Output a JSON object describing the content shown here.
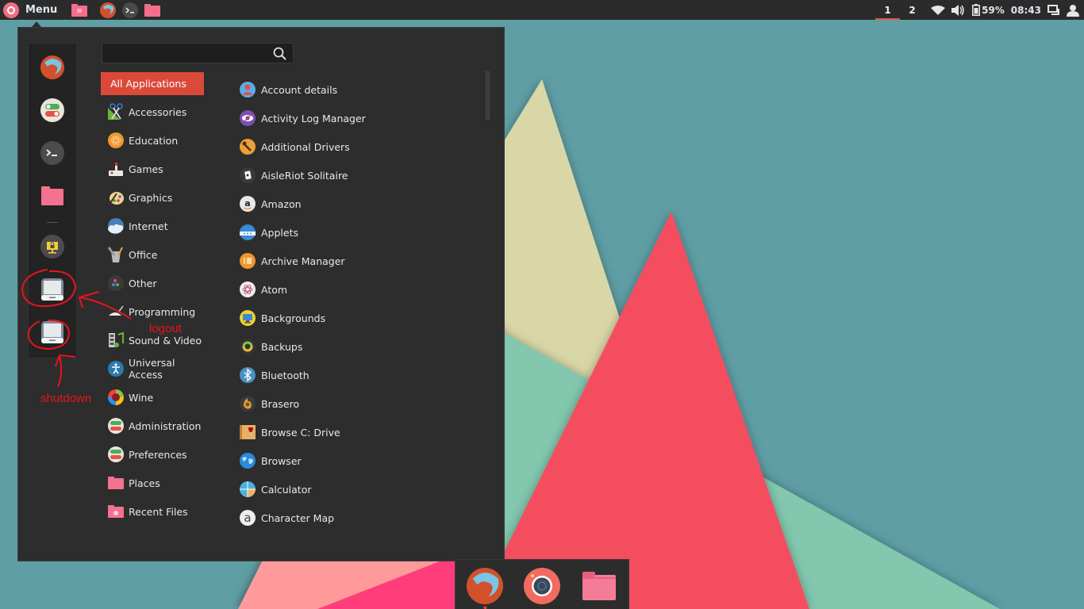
{
  "colors": {
    "panel_bg": "#2b2b2b",
    "menu_bg": "#2d2d2d",
    "accent": "#db4a39",
    "wallpaper_bg": "#5f9ea5",
    "annotation": "#e8141a"
  },
  "top_panel": {
    "menu_label": "Menu",
    "launchers": [
      {
        "name": "files-launcher",
        "icon": "folder-icon"
      },
      {
        "name": "firefox-launcher",
        "icon": "firefox-icon"
      },
      {
        "name": "terminal-launcher",
        "icon": "terminal-icon"
      },
      {
        "name": "folder-launcher",
        "icon": "folder-icon"
      }
    ],
    "workspaces": [
      "1",
      "2"
    ],
    "active_workspace": "1",
    "battery": "59%",
    "clock": "08:43"
  },
  "menu": {
    "search": {
      "value": "",
      "placeholder": ""
    },
    "favorites": [
      {
        "name": "firefox",
        "icon": "firefox-icon"
      },
      {
        "name": "system-settings",
        "icon": "settings-toggle-icon"
      },
      {
        "name": "terminal",
        "icon": "terminal-icon"
      },
      {
        "name": "files",
        "icon": "folder-icon"
      },
      {
        "name": "lock-screen",
        "icon": "lock-screen-icon"
      },
      {
        "name": "logout",
        "icon": "computer-icon"
      },
      {
        "name": "shutdown",
        "icon": "computer-icon"
      }
    ],
    "categories": [
      {
        "label": "All Applications",
        "selected": true
      },
      {
        "label": "Accessories"
      },
      {
        "label": "Education"
      },
      {
        "label": "Games"
      },
      {
        "label": "Graphics"
      },
      {
        "label": "Internet"
      },
      {
        "label": "Office"
      },
      {
        "label": "Other"
      },
      {
        "label": "Programming"
      },
      {
        "label": "Sound & Video"
      },
      {
        "label": "Universal Access"
      },
      {
        "label": "Wine"
      },
      {
        "label": "Administration"
      },
      {
        "label": "Preferences"
      },
      {
        "label": "Places"
      },
      {
        "label": "Recent Files"
      }
    ],
    "apps": [
      {
        "label": "Account details"
      },
      {
        "label": "Activity Log Manager"
      },
      {
        "label": "Additional Drivers"
      },
      {
        "label": "AisleRiot Solitaire"
      },
      {
        "label": "Amazon"
      },
      {
        "label": "Applets"
      },
      {
        "label": "Archive Manager"
      },
      {
        "label": "Atom"
      },
      {
        "label": "Backgrounds"
      },
      {
        "label": "Backups"
      },
      {
        "label": "Bluetooth"
      },
      {
        "label": "Brasero"
      },
      {
        "label": "Browse C: Drive"
      },
      {
        "label": "Browser"
      },
      {
        "label": "Calculator"
      },
      {
        "label": "Character Map"
      }
    ]
  },
  "annotations": {
    "logout": "logout",
    "shutdown": "shutdown"
  },
  "dock": {
    "items": [
      {
        "name": "firefox",
        "icon": "firefox-icon",
        "running": true
      },
      {
        "name": "camera",
        "icon": "camera-icon",
        "running": false
      },
      {
        "name": "files",
        "icon": "folder-icon",
        "running": false
      }
    ]
  }
}
